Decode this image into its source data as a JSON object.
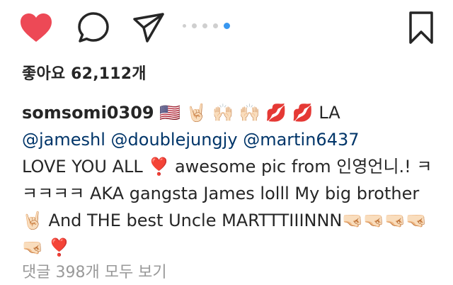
{
  "actions": {
    "like_color": "#ed4956",
    "icon_stroke": "#262626",
    "carousel": {
      "count": 5,
      "active_index": 4,
      "active_color": "#3897f0"
    }
  },
  "likes": "좋아요 62,112개",
  "caption": {
    "username": "somsomi0309",
    "line1_emojis": "🇺🇸 🤘🏻 🙌🏻 🙌🏻 💋 💋",
    "line1_tail": "LA",
    "mentions": [
      "@jameshl",
      "@doublejungjy",
      "@martin6437"
    ],
    "love": "LOVE YOU ALL",
    "heart": "❣️",
    "seg1": "awesome pic from 인영언니.! ㅋㅋㅋㅋㅋ AKA gangsta James lolll My big brother",
    "rock": "🤘🏻",
    "seg2": "And THE best Uncle MARTTTIIINNN",
    "fists": "🤜🏻🤜🏻🤜🏻🤜🏻🤜🏻",
    "end_heart": "❣️"
  },
  "view_comments": "댓글 398개 모두 보기"
}
